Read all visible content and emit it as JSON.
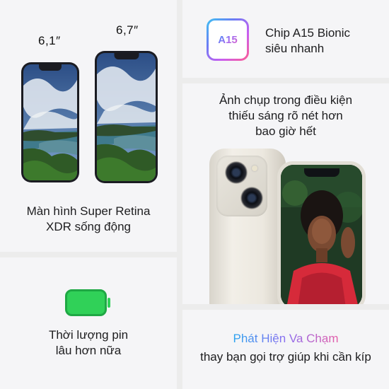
{
  "display": {
    "size_small": "6,1″",
    "size_large": "6,7″",
    "title_line1": "Màn hình Super Retina",
    "title_line2": "XDR sống động"
  },
  "chip": {
    "badge": "A15",
    "title_line1": "Chip A15 Bionic",
    "title_line2": "siêu nhanh"
  },
  "camera": {
    "title_line1": "Ảnh chụp trong điều kiện",
    "title_line2": "thiếu sáng rõ nét hơn",
    "title_line3": "bao giờ hết"
  },
  "battery": {
    "title_line1": "Thời lượng pin",
    "title_line2": "lâu hơn nữa",
    "color": "#30d158"
  },
  "sos": {
    "highlight": "Phát Hiện Va Chạm",
    "subtitle": "thay bạn gọi trợ giúp khi cần kíp"
  },
  "icons": [
    "iphone-front-icon",
    "a15-chip-icon",
    "camera-lens-icon",
    "battery-icon"
  ]
}
